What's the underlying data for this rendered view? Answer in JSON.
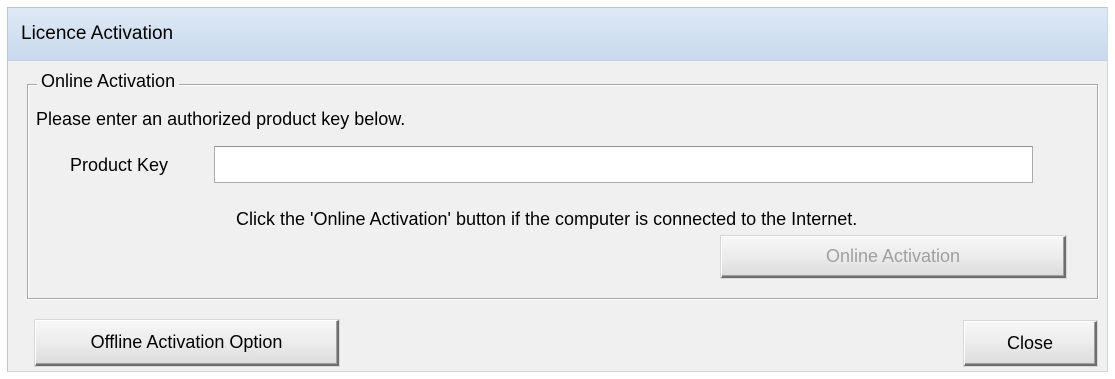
{
  "window": {
    "title": "Licence Activation"
  },
  "online_group": {
    "legend": "Online Activation",
    "instruction": "Please enter an authorized product key below.",
    "product_key_label": "Product Key",
    "product_key_value": "",
    "hint": "Click the 'Online Activation' button if the computer is connected to the Internet.",
    "online_button_label": "Online Activation",
    "online_button_enabled": false
  },
  "footer": {
    "offline_button_label": "Offline Activation Option",
    "close_button_label": "Close"
  }
}
